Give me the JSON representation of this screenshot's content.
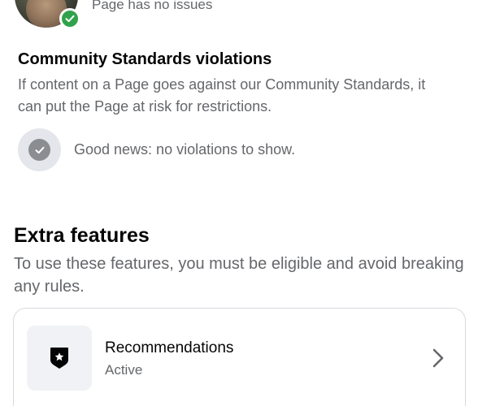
{
  "header": {
    "page_status": "Page has no issues"
  },
  "community_standards": {
    "title": "Community Standards violations",
    "description": "If content on a Page goes against our Community Standards, it can put the Page at risk for restrictions.",
    "good_news": "Good news: no violations to show."
  },
  "extra_features": {
    "title": "Extra features",
    "description": "To use these features, you must be eligible and avoid breaking any rules.",
    "items": [
      {
        "label": "Recommendations",
        "status": "Active",
        "icon": "shield-star-icon"
      }
    ]
  },
  "colors": {
    "success": "#31a24c",
    "secondary_text": "#65676b",
    "primary_text": "#050505"
  }
}
